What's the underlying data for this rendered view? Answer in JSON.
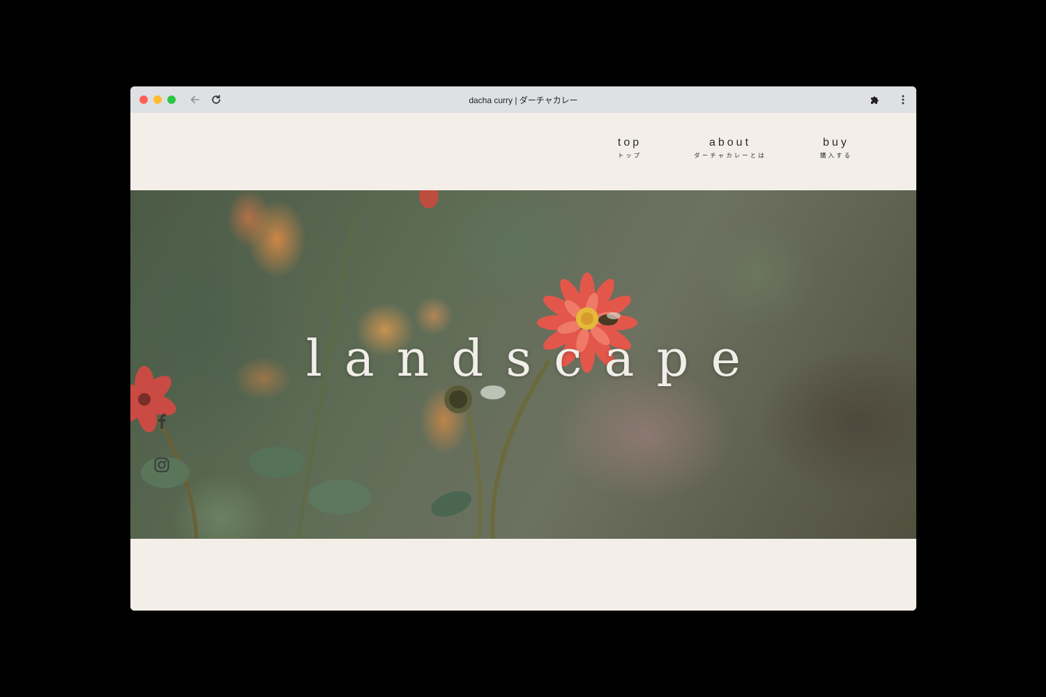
{
  "browser": {
    "tab_title": "dacha curry | ダーチャカレー",
    "icons": [
      "back-arrow-icon",
      "reload-icon",
      "extensions-puzzle-icon",
      "kebab-menu-icon"
    ]
  },
  "nav": {
    "items": [
      {
        "en": "top",
        "jp": "トップ"
      },
      {
        "en": "about",
        "jp": "ダーチャカレーとは"
      },
      {
        "en": "buy",
        "jp": "購入する"
      }
    ]
  },
  "hero": {
    "title": "landscape"
  },
  "social": {
    "icons": [
      "facebook-icon",
      "instagram-icon"
    ]
  },
  "colors": {
    "page_bg": "#f3efe8",
    "titlebar": "#dee0e4",
    "hero_text": "#f1eee9",
    "nav_text": "#2a2a2a"
  }
}
